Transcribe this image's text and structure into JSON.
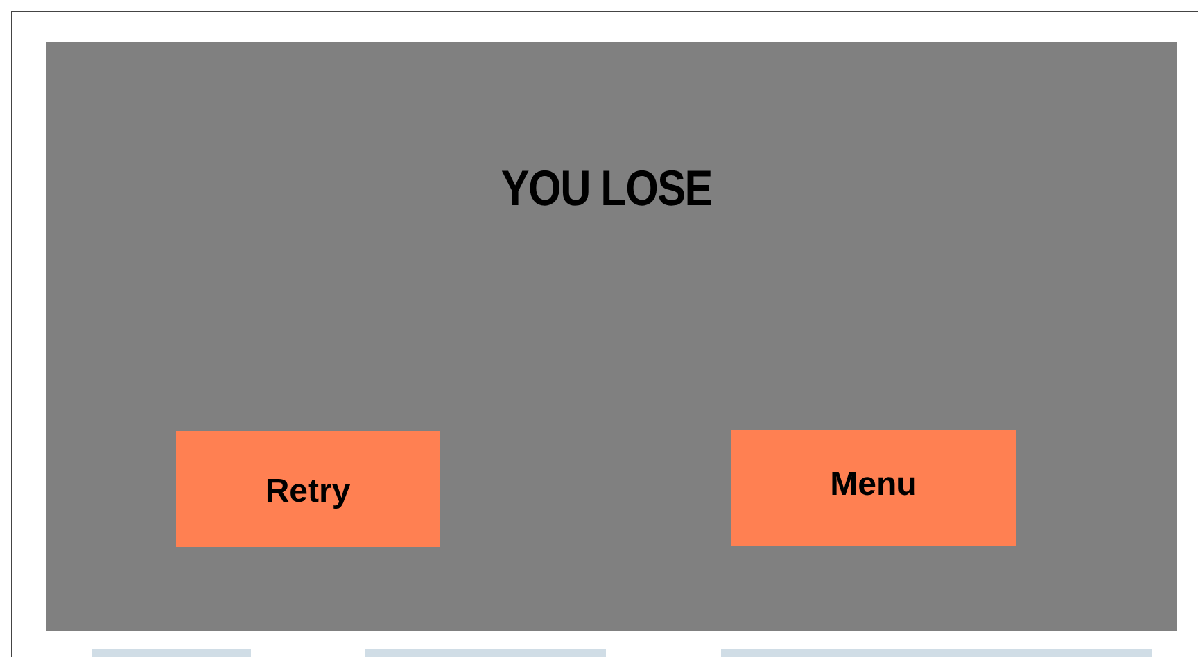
{
  "title": "YOU LOSE",
  "buttons": [
    {
      "label": "Retry"
    },
    {
      "label": "Menu"
    }
  ]
}
